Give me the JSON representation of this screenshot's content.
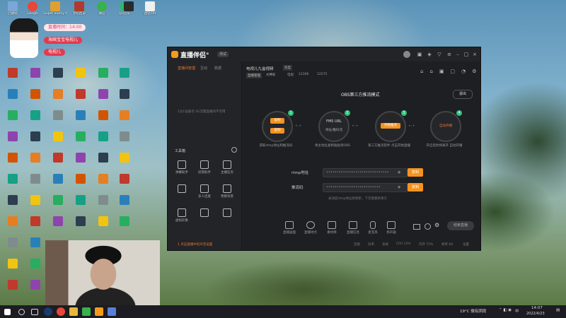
{
  "desktop": {
    "icons": [
      {
        "label": "回收站",
        "color": "#7aa7d8"
      },
      {
        "label": "Google",
        "color": "#e6473a"
      },
      {
        "label": "Super Bunny Man",
        "color": "#e0a030"
      },
      {
        "label": "梦幻西游",
        "color": "#b03a2e"
      },
      {
        "label": "微信",
        "color": "#38b24a"
      },
      {
        "label": "QQ音乐",
        "color": "#2fb86b"
      },
      {
        "label": "",
        "color": "#2b2b2b"
      },
      {
        "label": "西钻.txt",
        "color": "#f0f0f0"
      }
    ]
  },
  "overlay": {
    "live_timer": "直播时间：14:00",
    "nickname": "海绵宝宝电视儿",
    "handle": "电视儿"
  },
  "obs_window": {
    "app_title": "直播伴侣°",
    "version_badge": "测试",
    "sidebar": {
      "tabs": [
        "直播间管理",
        "互动",
        "数据"
      ],
      "empty_text": "1台1设备可 4G流量直播间不可用",
      "tools_title": "工具箱",
      "tools": [
        {
          "label": "弹幕助手",
          "icon": "danmu-icon"
        },
        {
          "label": "房管助手",
          "icon": "admin-icon"
        },
        {
          "label": "主播任务",
          "icon": "task-icon"
        },
        {
          "label": "",
          "icon": "gift-icon"
        },
        {
          "label": "多人连麦",
          "icon": "multi-link-icon"
        },
        {
          "label": "更换背景",
          "icon": "background-icon"
        },
        {
          "label": "虚拟形象",
          "icon": "avatar-icon"
        },
        {
          "label": "",
          "icon": "screen-icon"
        },
        {
          "label": "",
          "icon": "music-icon"
        }
      ],
      "footer_link": "1 点击直播中的声音设置"
    },
    "room": {
      "title": "电视儿九盒视频",
      "room_badge": "热度",
      "category": "直播管理",
      "streamer": "大神彩",
      "stat_label": "电视",
      "stat_value_1": "12306",
      "stat_value_2": "12575"
    },
    "mode": {
      "title": "OBS第三方推流模式",
      "exit_label": "退出",
      "steps": [
        {
          "num": "1",
          "caption": "获取rtmp地址和推流码",
          "btn_top": "复制",
          "btn_bottom": "复制"
        },
        {
          "num": "2",
          "caption": "将主地址复制粘贴到OBS",
          "line1": "FMS URL",
          "line2": "地址/推码流"
        },
        {
          "num": "3",
          "caption": "第三方推流软件 点击开始直播",
          "btn": "开始推流"
        },
        {
          "num": "4",
          "caption": "开启后你将离开 自动开播",
          "label": "自动开播"
        }
      ],
      "rtmp_label": "rtmp地址",
      "rtmp_value": "••••••••••••••••••••••••••••••",
      "key_label": "推流码",
      "key_value": "••••••••••••••••••••••••••",
      "copy_label": "复制",
      "hint": "关闭后rtmp地址将更新，下次需重新填写"
    },
    "toolbar": {
      "items": [
        "直播画面",
        "直播地点",
        "素材库",
        "直播信息",
        "麦克风",
        "扬声器"
      ],
      "right_button": "结束直播"
    },
    "status_bar": [
      "连接",
      "码率",
      "丢帧",
      "CPU 12%",
      "内存 75%",
      "帧率 60",
      "设置"
    ]
  },
  "taskbar": {
    "weather": "19°C 微有阴雨",
    "lang": "中",
    "time": "14:07",
    "date": "2022/4/23"
  }
}
